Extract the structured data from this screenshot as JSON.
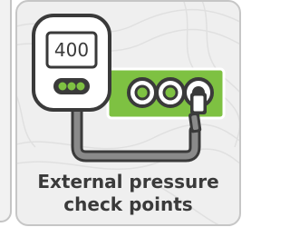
{
  "previous_tile": {},
  "tile": {
    "title_line_1": "External pressure",
    "title_line_2": "check points",
    "gauge_reading": "400",
    "icons": [
      "pressure-gauge-icon",
      "check-point-port-icon",
      "hose-icon"
    ]
  },
  "colors": {
    "accent_green": "#7ec142",
    "dark_outline": "#3a3a3a",
    "hose_grey": "#8a8a8a",
    "tile_background": "#efefef"
  }
}
